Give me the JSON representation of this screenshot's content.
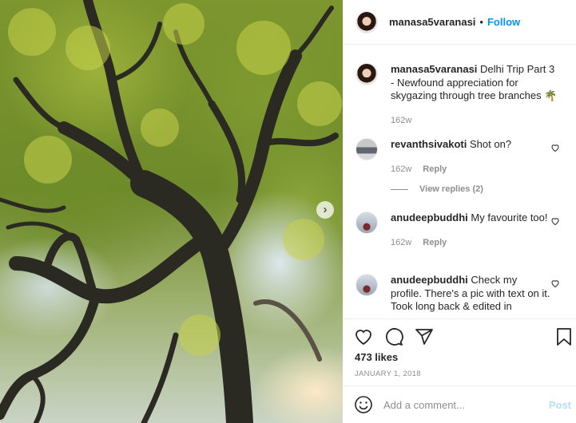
{
  "post": {
    "author": "manasa5varanasi",
    "follow_label": "Follow",
    "separator": "•",
    "caption_user": "manasa5varanasi",
    "caption_text": "Delhi Trip Part 3 - Newfound appreciation for skygazing through tree branches 🌴",
    "caption_time": "162w",
    "likes": "473 likes",
    "date": "JANUARY 1, 2018"
  },
  "comments": [
    {
      "user": "revanthsivakoti",
      "text": "Shot on?",
      "time": "162w",
      "reply_label": "Reply"
    },
    {
      "user": "anudeepbuddhi",
      "text": "My favourite too!",
      "time": "162w",
      "reply_label": "Reply"
    },
    {
      "user": "anudeepbuddhi",
      "text": "Check my profile. There's a pic with text on it. Took long back & edited in"
    }
  ],
  "view_replies": "View replies (2)",
  "add_comment": {
    "placeholder": "Add a comment...",
    "post_label": "Post"
  },
  "icons": [
    "heart-icon",
    "comment-icon",
    "share-icon",
    "bookmark-icon",
    "emoji-icon",
    "chevron-right-icon"
  ],
  "colors": {
    "link_blue": "#0095f6",
    "post_disabled": "#b2dffc",
    "muted": "#8e8e8e"
  }
}
